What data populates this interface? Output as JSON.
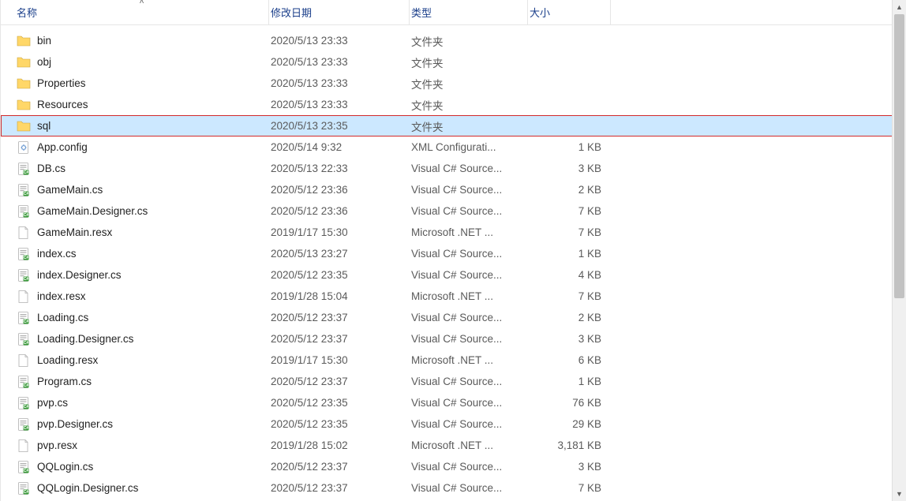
{
  "columns": {
    "name": "名称",
    "date": "修改日期",
    "type": "类型",
    "size": "大小"
  },
  "sort_indicator_glyph": "˄",
  "items": [
    {
      "icon": "folder",
      "name": "bin",
      "date": "2020/5/13 23:33",
      "type": "文件夹",
      "size": "",
      "selected": false
    },
    {
      "icon": "folder",
      "name": "obj",
      "date": "2020/5/13 23:33",
      "type": "文件夹",
      "size": "",
      "selected": false
    },
    {
      "icon": "folder",
      "name": "Properties",
      "date": "2020/5/13 23:33",
      "type": "文件夹",
      "size": "",
      "selected": false
    },
    {
      "icon": "folder",
      "name": "Resources",
      "date": "2020/5/13 23:33",
      "type": "文件夹",
      "size": "",
      "selected": false
    },
    {
      "icon": "folder",
      "name": "sql",
      "date": "2020/5/13 23:35",
      "type": "文件夹",
      "size": "",
      "selected": true
    },
    {
      "icon": "config",
      "name": "App.config",
      "date": "2020/5/14 9:32",
      "type": "XML Configurati...",
      "size": "1 KB",
      "selected": false
    },
    {
      "icon": "cs",
      "name": "DB.cs",
      "date": "2020/5/13 22:33",
      "type": "Visual C# Source...",
      "size": "3 KB",
      "selected": false
    },
    {
      "icon": "cs",
      "name": "GameMain.cs",
      "date": "2020/5/12 23:36",
      "type": "Visual C# Source...",
      "size": "2 KB",
      "selected": false
    },
    {
      "icon": "cs",
      "name": "GameMain.Designer.cs",
      "date": "2020/5/12 23:36",
      "type": "Visual C# Source...",
      "size": "7 KB",
      "selected": false
    },
    {
      "icon": "file",
      "name": "GameMain.resx",
      "date": "2019/1/17 15:30",
      "type": "Microsoft .NET ...",
      "size": "7 KB",
      "selected": false
    },
    {
      "icon": "cs",
      "name": "index.cs",
      "date": "2020/5/13 23:27",
      "type": "Visual C# Source...",
      "size": "1 KB",
      "selected": false
    },
    {
      "icon": "cs",
      "name": "index.Designer.cs",
      "date": "2020/5/12 23:35",
      "type": "Visual C# Source...",
      "size": "4 KB",
      "selected": false
    },
    {
      "icon": "file",
      "name": "index.resx",
      "date": "2019/1/28 15:04",
      "type": "Microsoft .NET ...",
      "size": "7 KB",
      "selected": false
    },
    {
      "icon": "cs",
      "name": "Loading.cs",
      "date": "2020/5/12 23:37",
      "type": "Visual C# Source...",
      "size": "2 KB",
      "selected": false
    },
    {
      "icon": "cs",
      "name": "Loading.Designer.cs",
      "date": "2020/5/12 23:37",
      "type": "Visual C# Source...",
      "size": "3 KB",
      "selected": false
    },
    {
      "icon": "file",
      "name": "Loading.resx",
      "date": "2019/1/17 15:30",
      "type": "Microsoft .NET ...",
      "size": "6 KB",
      "selected": false
    },
    {
      "icon": "cs",
      "name": "Program.cs",
      "date": "2020/5/12 23:37",
      "type": "Visual C# Source...",
      "size": "1 KB",
      "selected": false
    },
    {
      "icon": "cs",
      "name": "pvp.cs",
      "date": "2020/5/12 23:35",
      "type": "Visual C# Source...",
      "size": "76 KB",
      "selected": false
    },
    {
      "icon": "cs",
      "name": "pvp.Designer.cs",
      "date": "2020/5/12 23:35",
      "type": "Visual C# Source...",
      "size": "29 KB",
      "selected": false
    },
    {
      "icon": "file",
      "name": "pvp.resx",
      "date": "2019/1/28 15:02",
      "type": "Microsoft .NET ...",
      "size": "3,181 KB",
      "selected": false
    },
    {
      "icon": "cs",
      "name": "QQLogin.cs",
      "date": "2020/5/12 23:37",
      "type": "Visual C# Source...",
      "size": "3 KB",
      "selected": false
    },
    {
      "icon": "cs",
      "name": "QQLogin.Designer.cs",
      "date": "2020/5/12 23:37",
      "type": "Visual C# Source...",
      "size": "7 KB",
      "selected": false
    }
  ]
}
